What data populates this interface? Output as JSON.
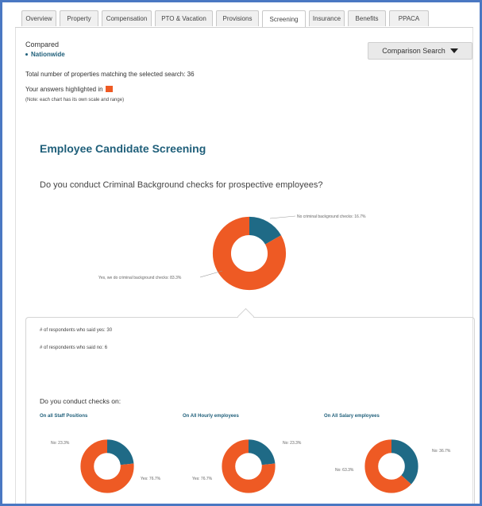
{
  "tabs": [
    {
      "label": "Overview",
      "width": 44,
      "active": false
    },
    {
      "label": "Property",
      "width": 49,
      "active": false
    },
    {
      "label": "Compensation",
      "width": 63,
      "active": false
    },
    {
      "label": "PTO & Vacation",
      "width": 73,
      "active": false
    },
    {
      "label": "Provisions",
      "width": 54,
      "active": false
    },
    {
      "label": "Screening",
      "width": 55,
      "active": true
    },
    {
      "label": "Insurance",
      "width": 45,
      "active": false
    },
    {
      "label": "Benefits",
      "width": 48,
      "active": false
    },
    {
      "label": "PPACA",
      "width": 50,
      "active": false
    }
  ],
  "header": {
    "compared_label": "Compared",
    "compared_value": "Nationwide",
    "comparison_button": "Comparison Search",
    "total_text": "Total number of properties matching the selected search: 36",
    "highlight_text": "Your answers highlighted in",
    "note_text": "(Note: each chart has its own scale and range)"
  },
  "section": {
    "title": "Employee Candidate Screening",
    "question": "Do you conduct Criminal Background checks for prospective employees?"
  },
  "main_chart": {
    "label_no": "No criminal background checks: 16.7%",
    "label_yes": "Yes, we do criminal background checks: 83.3%"
  },
  "respondents": {
    "yes_text": "# of respondents who said yes: 30",
    "no_text": "# of respondents who said no: 6"
  },
  "checks": {
    "title": "Do you conduct checks on:",
    "charts": [
      {
        "title": "On all Staff Positions",
        "no_label": "No: 23.3%",
        "yes_label": "Yes: 76.7%"
      },
      {
        "title": "On All Hourly employees",
        "no_label": "No: 23.3%",
        "yes_label": "Yes: 76.7%"
      },
      {
        "title": "On All Salary employees",
        "no_label": "No: 36.7%",
        "yes_label": "No: 63.3%"
      }
    ]
  },
  "chart_data": [
    {
      "type": "pie",
      "title": "Do you conduct Criminal Background checks for prospective employees?",
      "categories": [
        "No criminal background checks",
        "Yes, we do criminal background checks"
      ],
      "values": [
        16.7,
        83.3
      ],
      "colors": [
        "#1f6a86",
        "#ee5a24"
      ]
    },
    {
      "type": "pie",
      "title": "On all Staff Positions",
      "categories": [
        "No",
        "Yes"
      ],
      "values": [
        23.3,
        76.7
      ],
      "colors": [
        "#1f6a86",
        "#ee5a24"
      ]
    },
    {
      "type": "pie",
      "title": "On All Hourly employees",
      "categories": [
        "No",
        "Yes"
      ],
      "values": [
        23.3,
        76.7
      ],
      "colors": [
        "#1f6a86",
        "#ee5a24"
      ]
    },
    {
      "type": "pie",
      "title": "On All Salary employees",
      "categories": [
        "No",
        "No"
      ],
      "values": [
        36.7,
        63.3
      ],
      "colors": [
        "#1f6a86",
        "#ee5a24"
      ]
    }
  ]
}
